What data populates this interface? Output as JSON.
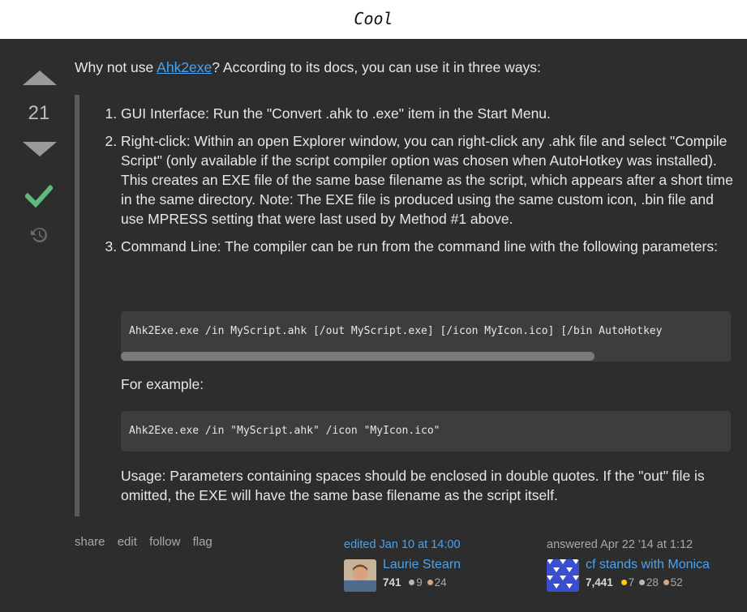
{
  "header": {
    "title": "Cool"
  },
  "votes": {
    "count": "21"
  },
  "answer": {
    "intro_before": "Why not use ",
    "intro_link": "Ahk2exe",
    "intro_after": "? According to its docs, you can use it in three ways:",
    "items": [
      "GUI Interface: Run the \"Convert .ahk to .exe\" item in the Start Menu.",
      "Right-click: Within an open Explorer window, you can right-click any .ahk file and select \"Compile Script\" (only available if the script compiler option was chosen when AutoHotkey was installed). This creates an EXE file of the same base filename as the script, which appears after a short time in the same directory. Note: The EXE file is produced using the same custom icon, .bin file and use MPRESS setting that were last used by Method #1 above.",
      "Command Line: The compiler can be run from the command line with the following parameters:"
    ],
    "code1": "Ahk2Exe.exe /in MyScript.ahk [/out MyScript.exe] [/icon MyIcon.ico] [/bin AutoHotkey",
    "example_label": "For example:",
    "code2": "Ahk2Exe.exe /in \"MyScript.ahk\" /icon \"MyIcon.ico\"",
    "usage": "Usage: Parameters containing spaces should be enclosed in double quotes. If the \"out\" file is omitted, the EXE will have the same base filename as the script itself."
  },
  "actions": {
    "share": "share",
    "edit": "edit",
    "follow": "follow",
    "flag": "flag"
  },
  "editor": {
    "action": "edited Jan 10 at 14:00",
    "name": "Laurie Stearn",
    "rep": "741",
    "silver": "9",
    "bronze": "24"
  },
  "author": {
    "action": "answered Apr 22 '14 at 1:12",
    "name": "cf stands with Monica",
    "rep": "7,441",
    "gold": "7",
    "silver": "28",
    "bronze": "52"
  },
  "colors": {
    "accent": "#4aa3f0",
    "accepted": "#5fba7d",
    "gold": "#ffcc01",
    "silver": "#b4b8bc",
    "bronze": "#d1a684"
  }
}
